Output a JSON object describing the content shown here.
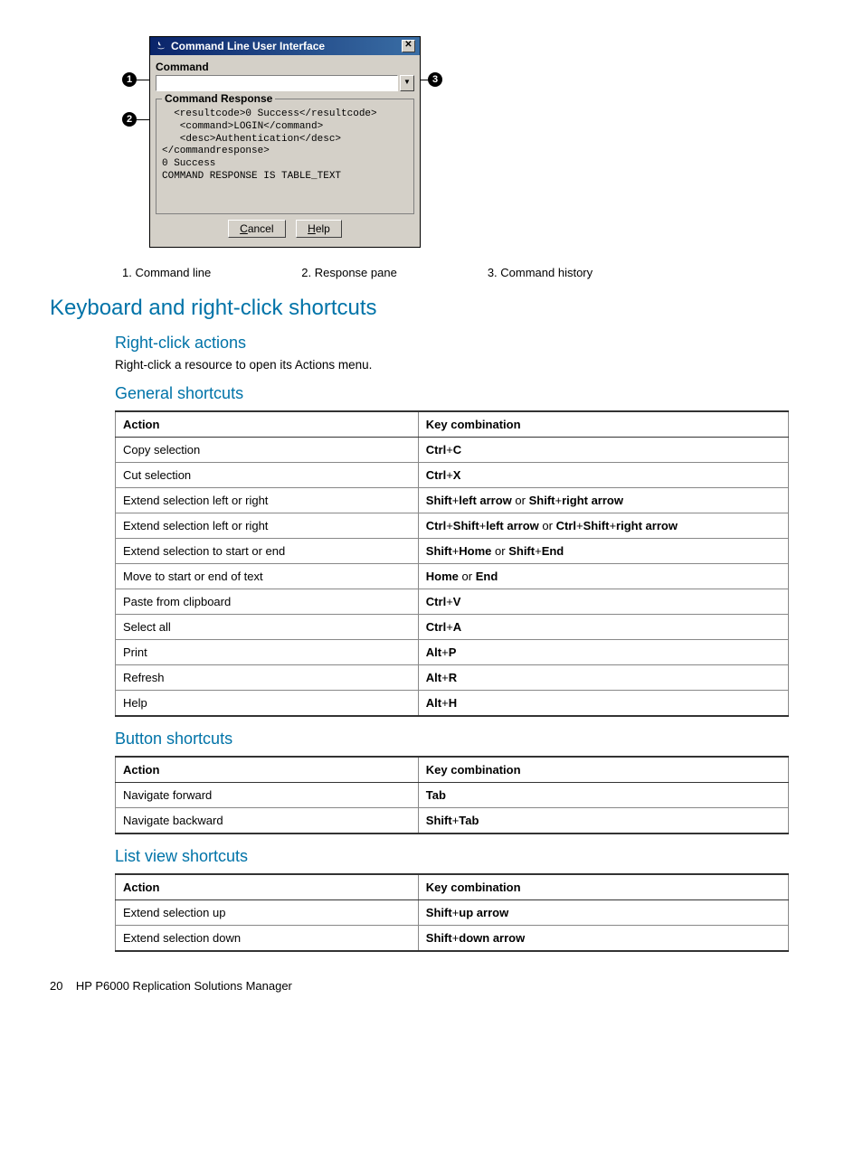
{
  "dialog": {
    "title": "Command Line User Interface",
    "command_label": "Command",
    "fieldset_label": "Command Response",
    "response_text": "  <resultcode>0 Success</resultcode>\n   <command>LOGIN</command>\n   <desc>Authentication</desc>\n</commandresponse>\n0 Success\nCOMMAND RESPONSE IS TABLE_TEXT",
    "cancel": "Cancel",
    "help": "Help"
  },
  "callouts": {
    "c1": "1",
    "c2": "2",
    "c3": "3",
    "legend1": "1. Command line",
    "legend2": "2. Response pane",
    "legend3": "3. Command history"
  },
  "headings": {
    "h2": "Keyboard and right-click shortcuts",
    "h3a": "Right-click actions",
    "h3b": "General shortcuts",
    "h3c": "Button shortcuts",
    "h3d": "List view shortcuts"
  },
  "body": {
    "rightclick": "Right-click a resource to open its Actions menu."
  },
  "table_headers": {
    "action": "Action",
    "key": "Key combination"
  },
  "general_shortcuts": [
    {
      "action": "Copy selection",
      "key": "<b>Ctrl</b>+<b>C</b>"
    },
    {
      "action": "Cut selection",
      "key": "<b>Ctrl</b>+<b>X</b>"
    },
    {
      "action": "Extend selection left or right",
      "key": "<b>Shift</b>+<b>left arrow</b> or <b>Shift</b>+<b>right arrow</b>"
    },
    {
      "action": "Extend selection left or right",
      "key": "<b>Ctrl</b>+<b>Shift</b>+<b>left arrow</b> or <b>Ctrl</b>+<b>Shift</b>+<b>right arrow</b>"
    },
    {
      "action": "Extend selection to start or end",
      "key": "<b>Shift</b>+<b>Home</b> or <b>Shift</b>+<b>End</b>"
    },
    {
      "action": "Move to start or end of text",
      "key": "<b>Home</b> or <b>End</b>"
    },
    {
      "action": "Paste from clipboard",
      "key": "<b>Ctrl</b>+<b>V</b>"
    },
    {
      "action": "Select all",
      "key": "<b>Ctrl</b>+<b>A</b>"
    },
    {
      "action": "Print",
      "key": "<b>Alt</b>+<b>P</b>"
    },
    {
      "action": "Refresh",
      "key": "<b>Alt</b>+<b>R</b>"
    },
    {
      "action": "Help",
      "key": "<b>Alt</b>+<b>H</b>"
    }
  ],
  "button_shortcuts": [
    {
      "action": "Navigate forward",
      "key": "<b>Tab</b>"
    },
    {
      "action": "Navigate backward",
      "key": "<b>Shift</b>+<b>Tab</b>"
    }
  ],
  "listview_shortcuts": [
    {
      "action": "Extend selection up",
      "key": "<b>Shift</b>+<b>up arrow</b>"
    },
    {
      "action": "Extend selection down",
      "key": "<b>Shift</b>+<b>down arrow</b>"
    }
  ],
  "footer": {
    "page": "20",
    "title": "HP P6000 Replication Solutions Manager"
  }
}
